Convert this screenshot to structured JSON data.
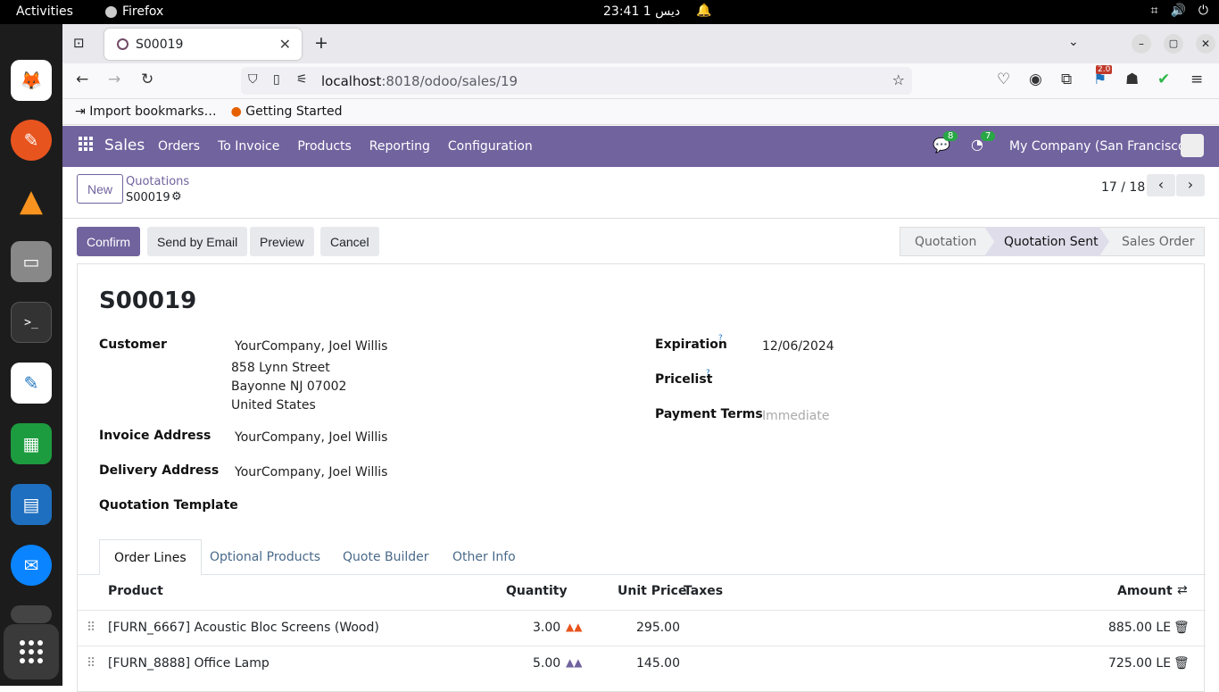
{
  "system": {
    "activities": "Activities",
    "app_name": "Firefox",
    "clock": "23:41  ديس 1"
  },
  "browser": {
    "tab_title": "S00019",
    "url_host": "localhost",
    "url_path": ":8018/odoo/sales/19",
    "bookmarks": [
      "Import bookmarks…",
      "Getting Started"
    ],
    "ext_badge": "2.0"
  },
  "odoo_nav": {
    "app": "Sales",
    "menu": [
      "Orders",
      "To Invoice",
      "Products",
      "Reporting",
      "Configuration"
    ],
    "messages_count": "8",
    "activities_count": "7",
    "company": "My Company (San Francisco)"
  },
  "control": {
    "new_label": "New",
    "breadcrumb_parent": "Quotations",
    "breadcrumb_current": "S00019",
    "pager": "17 / 18"
  },
  "actions": {
    "confirm": "Confirm",
    "send_email": "Send by Email",
    "preview": "Preview",
    "cancel": "Cancel"
  },
  "status_steps": [
    "Quotation",
    "Quotation Sent",
    "Sales Order"
  ],
  "form": {
    "title": "S00019",
    "customer_label": "Customer",
    "customer_name": "YourCompany, Joel Willis",
    "addr1": "858 Lynn Street",
    "addr2": "Bayonne NJ 07002",
    "addr3": "United States",
    "invoice_label": "Invoice Address",
    "invoice_value": "YourCompany, Joel Willis",
    "delivery_label": "Delivery Address",
    "delivery_value": "YourCompany, Joel Willis",
    "template_label": "Quotation Template",
    "expiration_label": "Expiration",
    "expiration_value": "12/06/2024",
    "pricelist_label": "Pricelist",
    "payment_label": "Payment Terms",
    "payment_placeholder": "Immediate"
  },
  "tabs": [
    "Order Lines",
    "Optional Products",
    "Quote Builder",
    "Other Info"
  ],
  "table": {
    "headers": {
      "product": "Product",
      "quantity": "Quantity",
      "unit_price": "Unit Price",
      "taxes": "Taxes",
      "amount": "Amount"
    },
    "rows": [
      {
        "product": "[FURN_6667] Acoustic Bloc Screens (Wood)",
        "qty": "3.00",
        "price": "295.00",
        "amount": "885.00 LE"
      },
      {
        "product": "[FURN_8888] Office Lamp",
        "qty": "5.00",
        "price": "145.00",
        "amount": "725.00 LE"
      }
    ]
  },
  "colors": {
    "brand": "#71639e",
    "confirm": "#71639e"
  }
}
